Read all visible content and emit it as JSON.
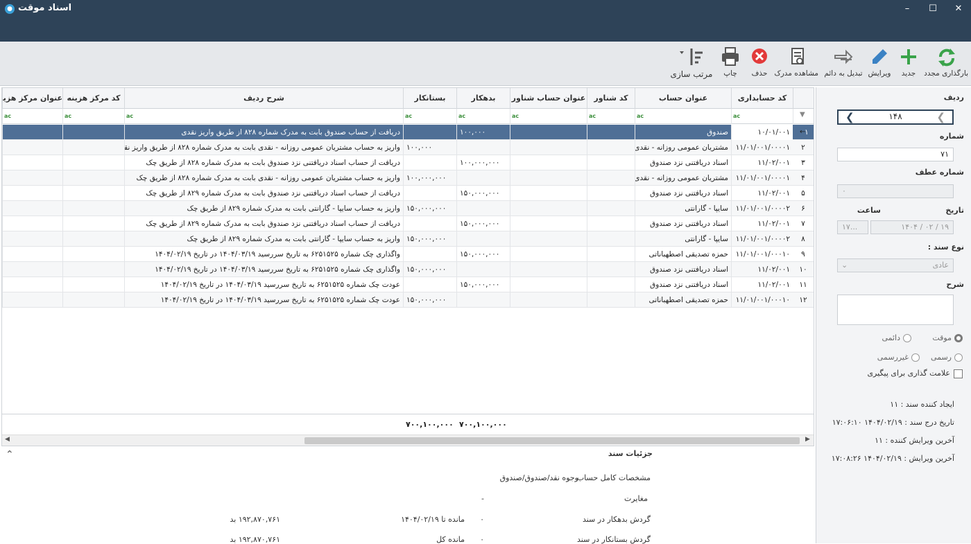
{
  "window": {
    "title": "اسناد موقت",
    "minimize": "–",
    "maximize": "☐",
    "close": "✕"
  },
  "toolbar": {
    "reload": "بارگذاری مجدد",
    "new": "جدید",
    "edit": "ویرایش",
    "convert": "تبدیل به دائم",
    "view_doc": "مشاهده مدرک",
    "delete": "حذف",
    "print": "چاپ",
    "sort": "مرتب سازی"
  },
  "grid": {
    "columns": {
      "code": "کد حسابداری",
      "title": "عنوان حساب",
      "float_code": "کد شناور",
      "float_title": "عنوان حساب شناور",
      "debit": "بدهکار",
      "credit": "بستانکار",
      "desc": "شرح ردیف",
      "cost_code": "کد مرکز هزینه",
      "cost_title": "عنوان مرکز هزینه"
    },
    "rows": [
      {
        "rn": "۱",
        "code": "۱۰/۰۱/۰۰۱",
        "title": "صندوق",
        "debit": "۱۰۰,۰۰۰",
        "credit": "",
        "desc": "دریافت از حساب صندوق بابت  به مدرک شماره ۸۲۸ از طریق واریز نقدی"
      },
      {
        "rn": "۲",
        "code": "۱۱/۰۱/۰۰۱/۰۰۰۰۱",
        "title": "مشتریان عمومی روزانه - نقدی",
        "debit": "",
        "credit": "۱۰۰,۰۰۰",
        "desc": "واریز به حساب مشتریان عمومی روزانه - نقدی بابت  به مدرک شماره ۸۲۸ از طریق واریز نقدی"
      },
      {
        "rn": "۳",
        "code": "۱۱/۰۲/۰۰۱",
        "title": "اسناد دریافتنی نزد صندوق",
        "debit": "۱۰۰,۰۰۰,۰۰۰",
        "credit": "",
        "desc": "دریافت از حساب اسناد دریافتنی نزد صندوق بابت  به مدرک شماره ۸۲۸ از طریق چک"
      },
      {
        "rn": "۴",
        "code": "۱۱/۰۱/۰۰۱/۰۰۰۰۱",
        "title": "مشتریان عمومی روزانه - نقدی",
        "debit": "",
        "credit": "۱۰۰,۰۰۰,۰۰۰",
        "desc": "واریز به حساب مشتریان عمومی روزانه - نقدی بابت  به مدرک شماره ۸۲۸ از طریق چک"
      },
      {
        "rn": "۵",
        "code": "۱۱/۰۲/۰۰۱",
        "title": "اسناد دریافتنی نزد صندوق",
        "debit": "۱۵۰,۰۰۰,۰۰۰",
        "credit": "",
        "desc": "دریافت از حساب اسناد دریافتنی نزد صندوق بابت  به مدرک شماره ۸۲۹ از طریق چک"
      },
      {
        "rn": "۶",
        "code": "۱۱/۰۱/۰۰۱/۰۰۰۰۲",
        "title": "سایپا - گارانتی",
        "debit": "",
        "credit": "۱۵۰,۰۰۰,۰۰۰",
        "desc": "واریز به حساب سایپا - گارانتی بابت  به مدرک شماره ۸۲۹ از طریق چک"
      },
      {
        "rn": "۷",
        "code": "۱۱/۰۲/۰۰۱",
        "title": "اسناد دریافتنی نزد صندوق",
        "debit": "۱۵۰,۰۰۰,۰۰۰",
        "credit": "",
        "desc": "دریافت از حساب اسناد دریافتنی نزد صندوق بابت  به مدرک شماره ۸۲۹ از طریق چک"
      },
      {
        "rn": "۸",
        "code": "۱۱/۰۱/۰۰۱/۰۰۰۰۲",
        "title": "سایپا - گارانتی",
        "debit": "",
        "credit": "۱۵۰,۰۰۰,۰۰۰",
        "desc": "واریز به حساب سایپا - گارانتی بابت  به مدرک شماره ۸۲۹ از طریق چک"
      },
      {
        "rn": "۹",
        "code": "۱۱/۰۱/۰۰۱/۰۰۰۱۰",
        "title": "حمزه تصدیقی اصطهباناتی",
        "debit": "۱۵۰,۰۰۰,۰۰۰",
        "credit": "",
        "desc": "واگذاری چک شماره ۶۲۵۱۵۲۵ به تاریخ سررسید ۱۴۰۴/۰۳/۱۹ در تاریخ ۱۴۰۴/۰۲/۱۹"
      },
      {
        "rn": "۱۰",
        "code": "۱۱/۰۲/۰۰۱",
        "title": "اسناد دریافتنی نزد صندوق",
        "debit": "",
        "credit": "۱۵۰,۰۰۰,۰۰۰",
        "desc": "واگذاری چک شماره ۶۲۵۱۵۲۵ به تاریخ سررسید ۱۴۰۴/۰۳/۱۹ در تاریخ ۱۴۰۴/۰۲/۱۹"
      },
      {
        "rn": "۱۱",
        "code": "۱۱/۰۲/۰۰۱",
        "title": "اسناد دریافتنی نزد صندوق",
        "debit": "۱۵۰,۰۰۰,۰۰۰",
        "credit": "",
        "desc": "عودت چک شماره ۶۲۵۱۵۲۵ به تاریخ سررسید ۱۴۰۴/۰۳/۱۹ در تاریخ ۱۴۰۴/۰۲/۱۹"
      },
      {
        "rn": "۱۲",
        "code": "۱۱/۰۱/۰۰۱/۰۰۰۱۰",
        "title": "حمزه تصدیقی اصطهباناتی",
        "debit": "",
        "credit": "۱۵۰,۰۰۰,۰۰۰",
        "desc": "عودت چک شماره ۶۲۵۱۵۲۵ به تاریخ سررسید ۱۴۰۴/۰۳/۱۹ در تاریخ ۱۴۰۴/۰۲/۱۹"
      }
    ],
    "total_debit": "۷۰۰,۱۰۰,۰۰۰",
    "total_credit": "۷۰۰,۱۰۰,۰۰۰"
  },
  "details": {
    "header": "جزئیات سند",
    "account_full_label": "مشخصات کامل حساب",
    "account_full_value": "وجوه نقد/صندوق/صندوق",
    "discrepancy_label": "مغایرت",
    "discrepancy_value": "-",
    "debit_turnover_label": "گردش بدهکار در سند",
    "debit_turnover_value": "۰",
    "balance_to_label": "مانده تا ۱۴۰۴/۰۲/۱۹",
    "balance_to_value": "۱۹۲,۸۷۰,۷۶۱ بد",
    "credit_turnover_label": "گردش بستانکار در سند",
    "credit_turnover_value": "۰",
    "total_balance_label": "مانده کل",
    "total_balance_value": "۱۹۲,۸۷۰,۷۶۱ بد"
  },
  "side": {
    "row_label": "ردیف",
    "row_value": "۱۴۸",
    "number_label": "شماره",
    "number_value": "۷۱",
    "ref_number_label": "شماره عطف",
    "ref_number_value": "۰",
    "date_label": "تاریخ",
    "time_label": "ساعت",
    "date_day": "۱۹",
    "date_month": "۰۲",
    "date_year": "۱۴۰۴",
    "time_value": "۱۷...",
    "doc_type_label": "نوع سند :",
    "doc_type_value": "عادی",
    "desc_label": "شرح",
    "radio_temp": "موقت",
    "radio_perm": "دائمی",
    "radio_official": "رسمی",
    "radio_unofficial": "غیررسمی",
    "followup_label": "علامت گذاری برای پیگیری",
    "creator": "ایجاد کننده سند : ۱۱",
    "insert_date": "تاریخ درج سند : ۱۴۰۴/۰۲/۱۹ ۱۷:۰۶:۱۰",
    "last_editor": "آخرین ویرایش کننده : ۱۱",
    "last_edit": "آخرین ویرایش : ۱۴۰۴/۰۲/۱۹ ۱۷:۰۸:۲۶"
  },
  "colors": {
    "titlebar": "#2e4358",
    "selected_row": "#4f6f96",
    "toolbar": "#e6e8eb",
    "green": "#3aa34a",
    "red": "#e23a3a",
    "blue": "#3b82c4"
  }
}
